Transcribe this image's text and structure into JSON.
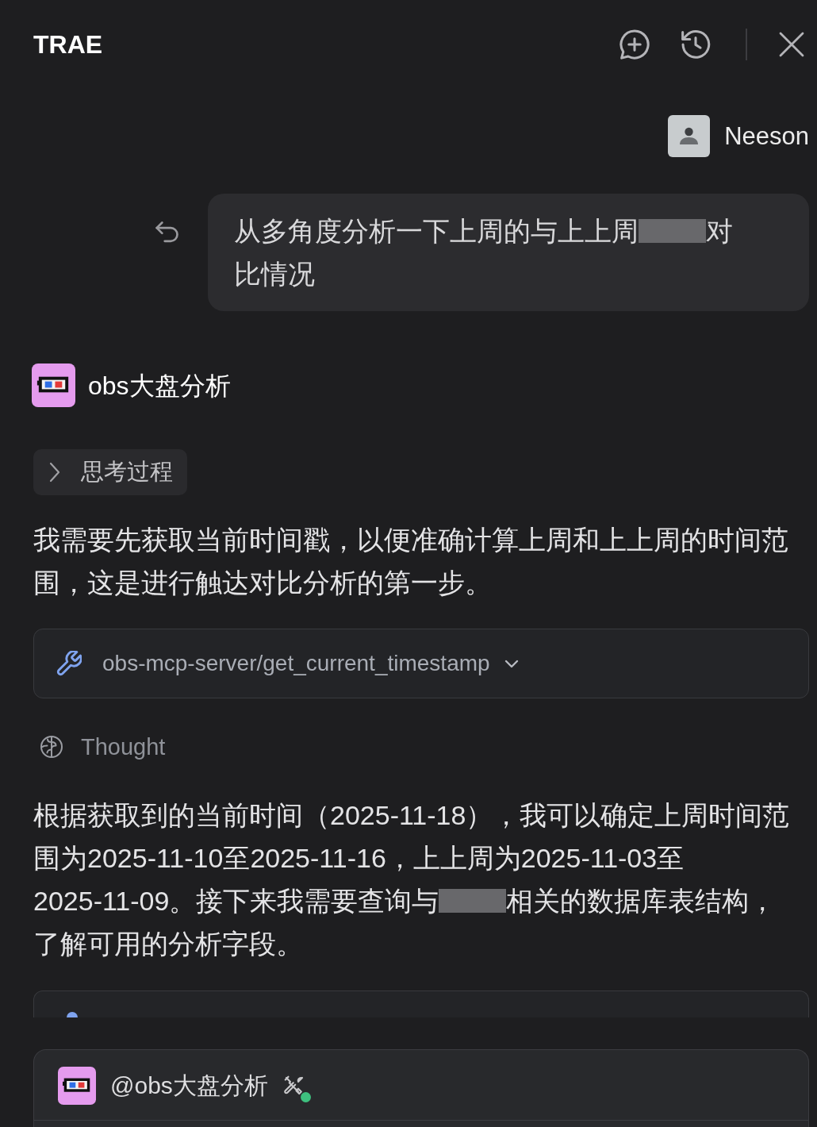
{
  "header": {
    "title": "TRAE"
  },
  "conversation": [
    {
      "kind": "user",
      "name": "Neeson",
      "lines": [
        [
          {
            "kind": "text",
            "text": "从多角度分析一下上周的与上上周"
          },
          {
            "kind": "redacted"
          },
          {
            "kind": "text",
            "text": "对"
          }
        ],
        [
          {
            "kind": "text",
            "text": "比情况"
          }
        ]
      ]
    },
    {
      "kind": "agent",
      "name": "obs大盘分析",
      "items": [
        {
          "kind": "thinking",
          "label": "思考过程",
          "expanded": false
        },
        {
          "kind": "text",
          "text": "我需要先获取当前时间戳，以便准确计算上周和上上周的时间范围，这是进行触达对比分析的第一步。"
        },
        {
          "kind": "tool_call",
          "label": "obs-mcp-server/get_current_timestamp",
          "expanded": false
        },
        {
          "kind": "thought",
          "label": "Thought"
        },
        {
          "kind": "lined_text",
          "lines": [
            [
              {
                "kind": "text",
                "text": "根据获取到的当前时间（2025-11-18），我可以确定上周时间范"
              }
            ],
            [
              {
                "kind": "text",
                "text": "围为2025-11-10至2025-11-16，上上周为2025-11-03至"
              }
            ],
            [
              {
                "kind": "text",
                "text": "2025-11-09。接下来我需要查询与"
              },
              {
                "kind": "redacted"
              },
              {
                "kind": "text",
                "text": "相关的数据库表结构，"
              }
            ],
            [
              {
                "kind": "text",
                "text": "了解可用的分析字段。"
              }
            ]
          ]
        },
        {
          "kind": "card_edge"
        }
      ]
    }
  ],
  "composer": {
    "mention": "@obs大盘分析",
    "tools_connected": true
  }
}
